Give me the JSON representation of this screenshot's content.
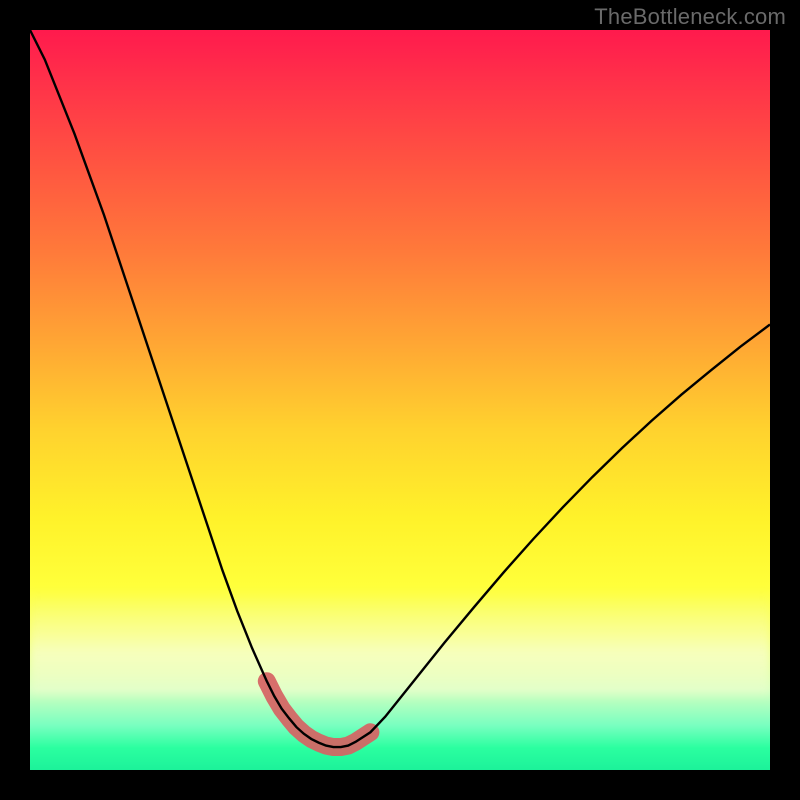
{
  "watermark": "TheBottleneck.com",
  "colors": {
    "frame_bg": "#000000",
    "gradient_top": "#ff1a4d",
    "gradient_bottom": "#1cf29a",
    "curve": "#000000",
    "overlay": "#d66363"
  },
  "chart_data": {
    "type": "line",
    "title": "",
    "xlabel": "",
    "ylabel": "",
    "xlim": [
      0,
      100
    ],
    "ylim": [
      0,
      100
    ],
    "grid": false,
    "legend": false,
    "x": [
      0,
      2,
      4,
      6,
      8,
      10,
      12,
      14,
      16,
      18,
      20,
      22,
      24,
      26,
      28,
      30,
      32,
      33,
      34,
      35,
      36,
      37,
      38,
      39,
      40,
      41,
      42,
      43,
      44,
      46,
      48,
      52,
      56,
      60,
      64,
      68,
      72,
      76,
      80,
      84,
      88,
      92,
      96,
      100
    ],
    "values": [
      100,
      96,
      91,
      86,
      80.5,
      75,
      69,
      63,
      57,
      51,
      45,
      39,
      33,
      27,
      21.5,
      16.5,
      12,
      10,
      8.3,
      7,
      5.8,
      4.9,
      4.2,
      3.7,
      3.3,
      3.1,
      3.1,
      3.3,
      3.8,
      5.1,
      7.2,
      12.2,
      17.2,
      22,
      26.7,
      31.2,
      35.5,
      39.6,
      43.5,
      47.2,
      50.7,
      54,
      57.2,
      60.2
    ],
    "note": "Curve traces the black line; values are approximate % of plot height from bottom (0 = bottom, 100 = top).",
    "overlay": {
      "description": "thick salmon segment highlighting the trough region",
      "x_range": [
        31,
        47
      ],
      "stroke_width_px": 18
    }
  }
}
